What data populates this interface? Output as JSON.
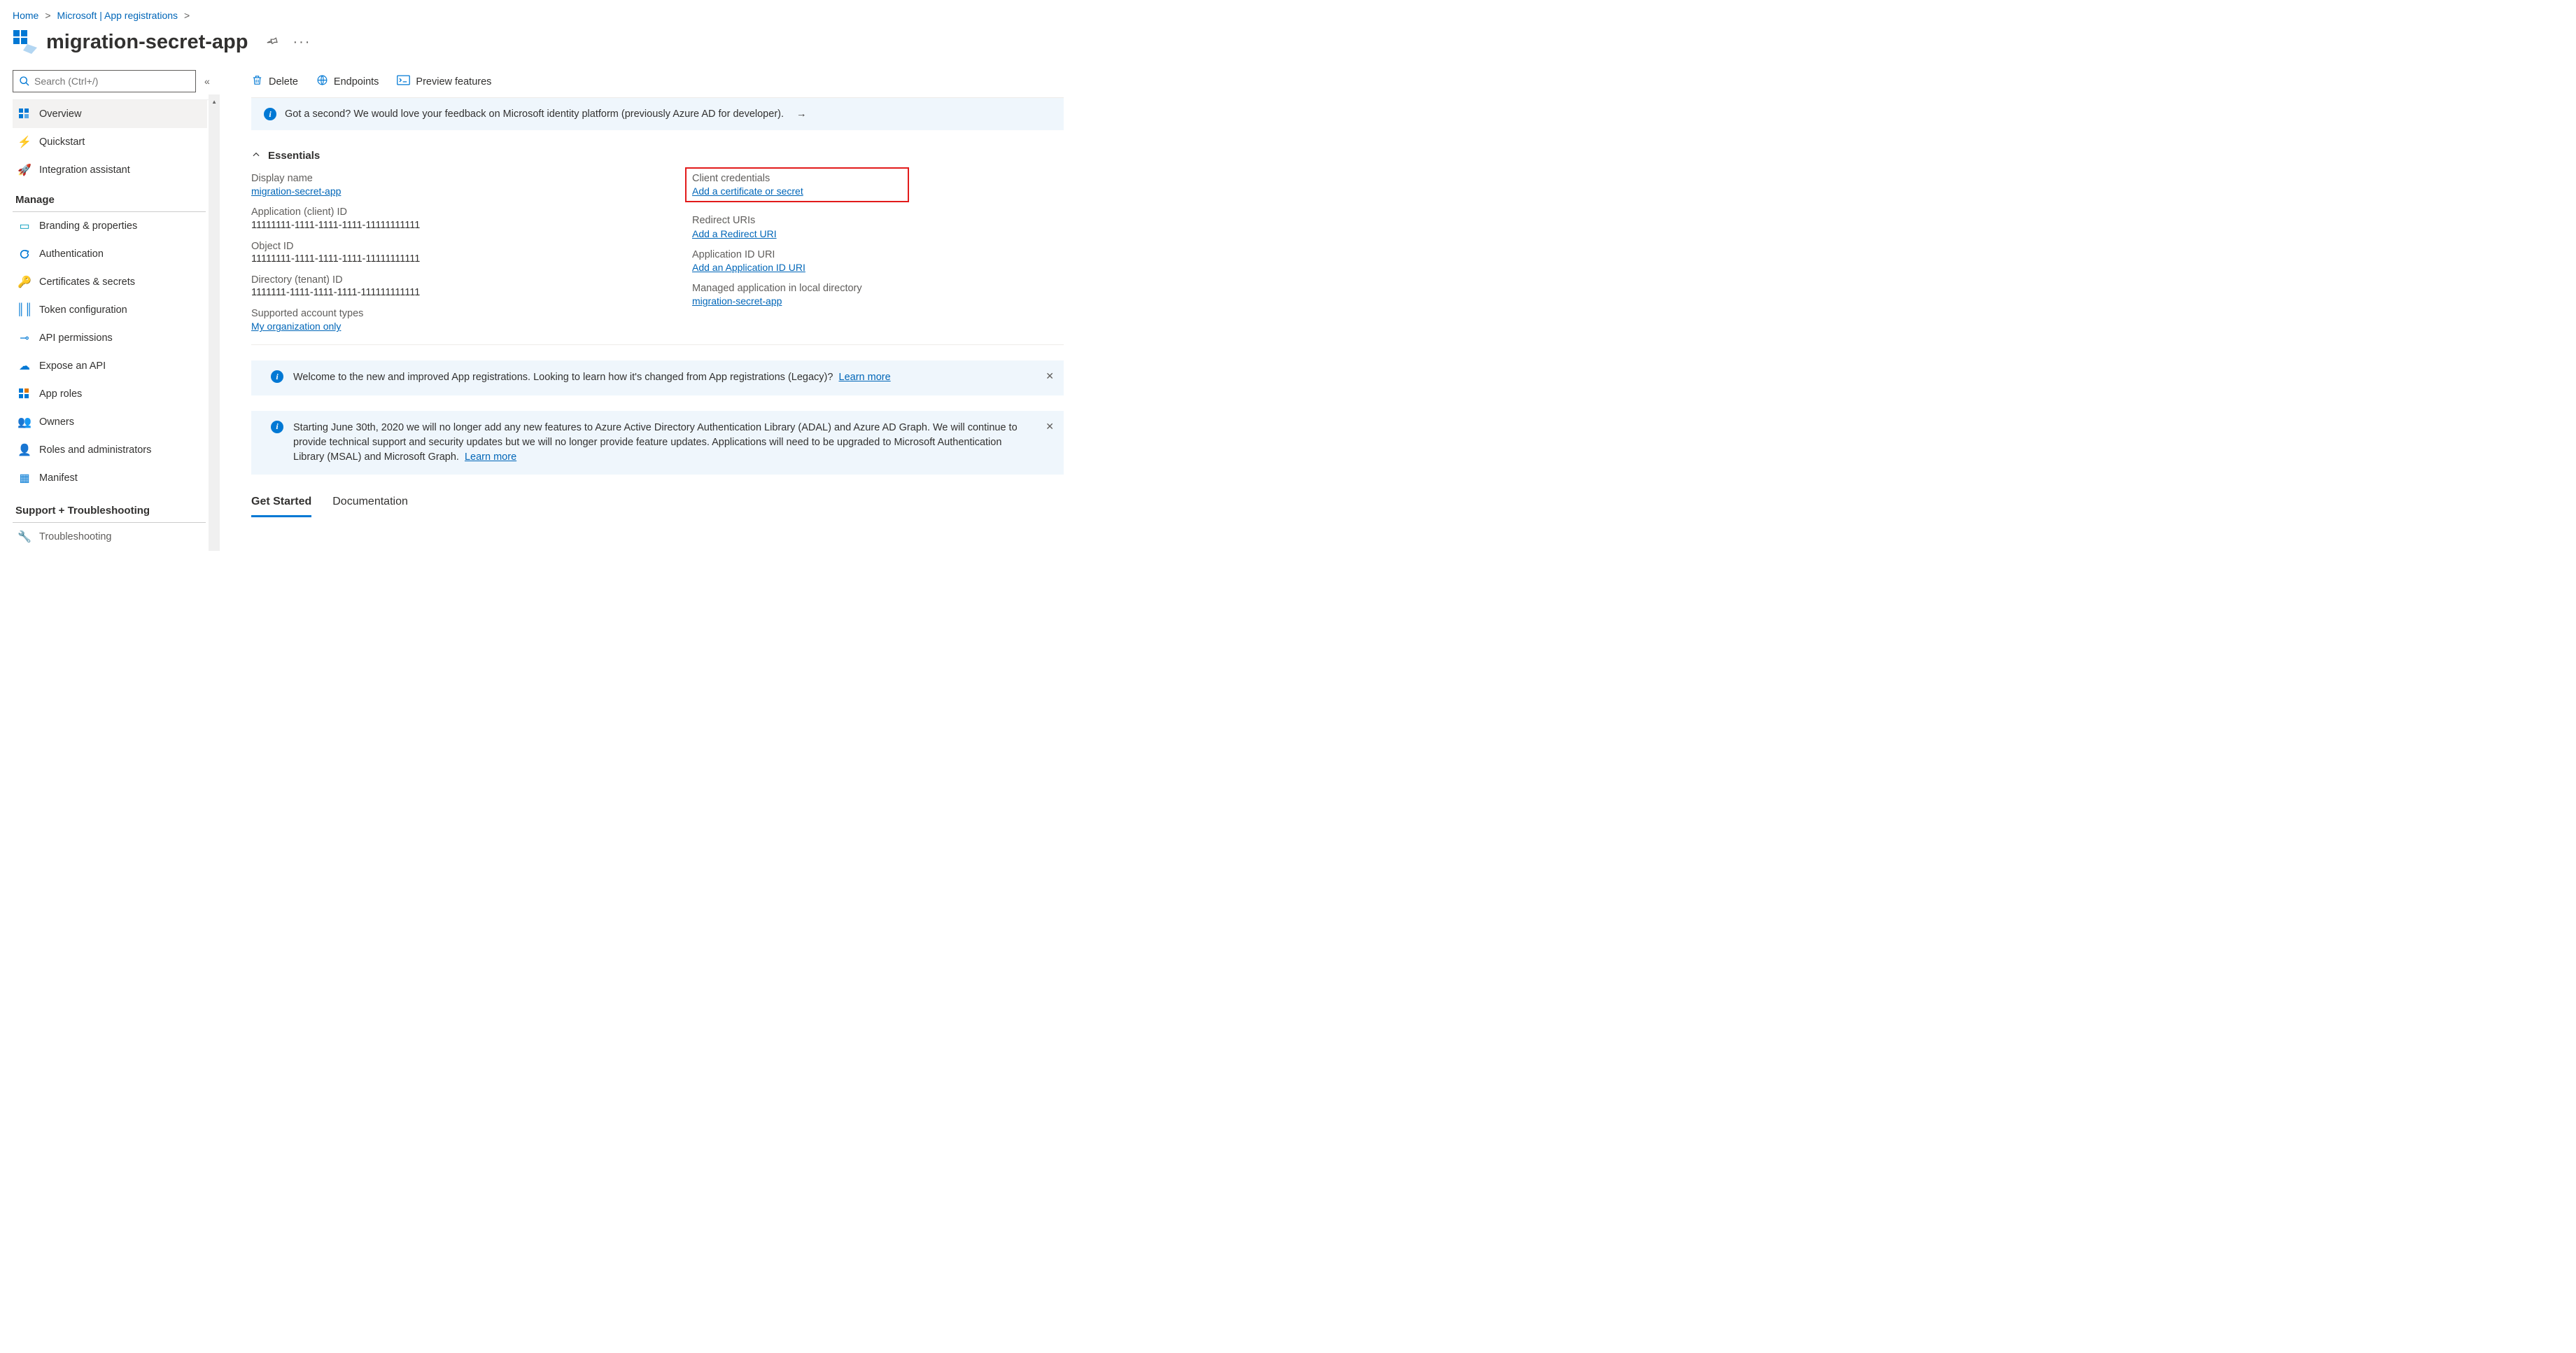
{
  "breadcrumb": {
    "home": "Home",
    "app_reg": "Microsoft | App registrations"
  },
  "title": "migration-secret-app",
  "sidebar": {
    "search_placeholder": "Search (Ctrl+/)",
    "overview": "Overview",
    "quickstart": "Quickstart",
    "integration": "Integration assistant",
    "section_manage": "Manage",
    "branding": "Branding & properties",
    "authentication": "Authentication",
    "certificates": "Certificates & secrets",
    "token": "Token configuration",
    "api_permissions": "API permissions",
    "expose": "Expose an API",
    "app_roles": "App roles",
    "owners": "Owners",
    "roles_admin": "Roles and administrators",
    "manifest": "Manifest",
    "section_support": "Support + Troubleshooting",
    "troubleshooting": "Troubleshooting"
  },
  "toolbar": {
    "delete": "Delete",
    "endpoints": "Endpoints",
    "preview": "Preview features"
  },
  "feedback_banner": "Got a second? We would love your feedback on Microsoft identity platform (previously Azure AD for developer).",
  "essentials": {
    "title": "Essentials",
    "display_name_label": "Display name",
    "display_name_value": "migration-secret-app",
    "app_id_label": "Application (client) ID",
    "app_id_value": "11111111-1111-1111-1111-11111111111",
    "object_id_label": "Object ID",
    "object_id_value": "11111111-1111-1111-1111-11111111111",
    "tenant_id_label": "Directory (tenant) ID",
    "tenant_id_value": "1111111-1111-1111-1111-111111111111",
    "account_types_label": "Supported account types",
    "account_types_value": "My organization only",
    "client_creds_label": "Client credentials",
    "client_creds_value": "Add a certificate or secret",
    "redirect_label": "Redirect URIs",
    "redirect_value": "Add a Redirect URI",
    "appid_uri_label": "Application ID URI",
    "appid_uri_value": "Add an Application ID URI",
    "managed_label": "Managed application in local directory",
    "managed_value": "migration-secret-app"
  },
  "welcome_box": {
    "text": "Welcome to the new and improved App registrations. Looking to learn how it's changed from App registrations (Legacy)?",
    "link": "Learn more"
  },
  "adal_box": {
    "text": "Starting June 30th, 2020 we will no longer add any new features to Azure Active Directory Authentication Library (ADAL) and Azure AD Graph. We will continue to provide technical support and security updates but we will no longer provide feature updates. Applications will need to be upgraded to Microsoft Authentication Library (MSAL) and Microsoft Graph.",
    "link": "Learn more"
  },
  "tabs": {
    "get_started": "Get Started",
    "documentation": "Documentation"
  }
}
